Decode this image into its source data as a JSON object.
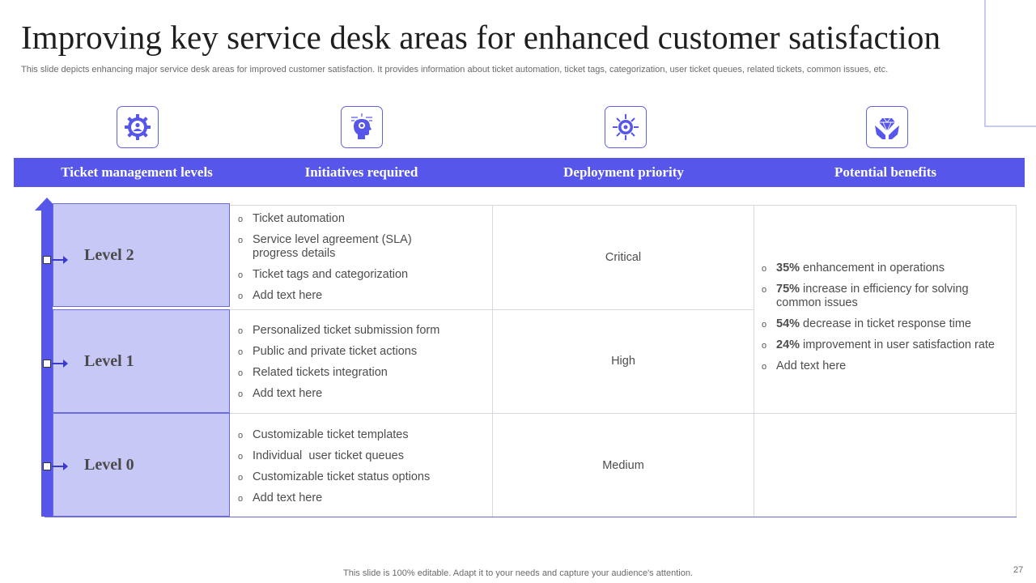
{
  "title": "Improving key service desk areas for enhanced customer satisfaction",
  "subtitle": "This slide depicts enhancing major service desk areas for improved customer satisfaction. It provides information about ticket automation, ticket tags,  categorization, user ticket queues, related tickets, common issues, etc.",
  "headers": [
    "Ticket management levels",
    "Initiatives required",
    "Deployment priority",
    "Potential benefits"
  ],
  "icons": [
    "gear-user-icon",
    "head-idea-icon",
    "gear-target-icon",
    "hands-diamond-icon"
  ],
  "levels": [
    {
      "label": "Level 2",
      "initiatives": [
        "Ticket automation",
        "Service level agreement (SLA) progress details",
        "Ticket tags and categorization",
        "Add text here"
      ],
      "priority": "Critical"
    },
    {
      "label": "Level 1",
      "initiatives": [
        "Personalized ticket submission form",
        "Public and private ticket actions",
        "Related tickets integration",
        "Add text here"
      ],
      "priority": "High"
    },
    {
      "label": "Level 0",
      "initiatives": [
        "Customizable ticket templates",
        "Individual  user ticket queues",
        "Customizable ticket status options",
        "Add text here"
      ],
      "priority": "Medium"
    }
  ],
  "benefits": [
    {
      "highlight": "35%",
      "text": " enhancement in operations"
    },
    {
      "highlight": "75%",
      "text": " increase in efficiency for solving common issues"
    },
    {
      "highlight": "54%",
      "text": " decrease in ticket response time"
    },
    {
      "highlight": "24%",
      "text": " improvement in user satisfaction rate"
    },
    {
      "highlight": "",
      "text": "Add text here"
    }
  ],
  "footer": "This slide is 100% editable. Adapt it to your needs and capture your audience's attention.",
  "page_number": "27",
  "colors": {
    "accent": "#5656ea",
    "level_fill": "#c8c8f6"
  }
}
